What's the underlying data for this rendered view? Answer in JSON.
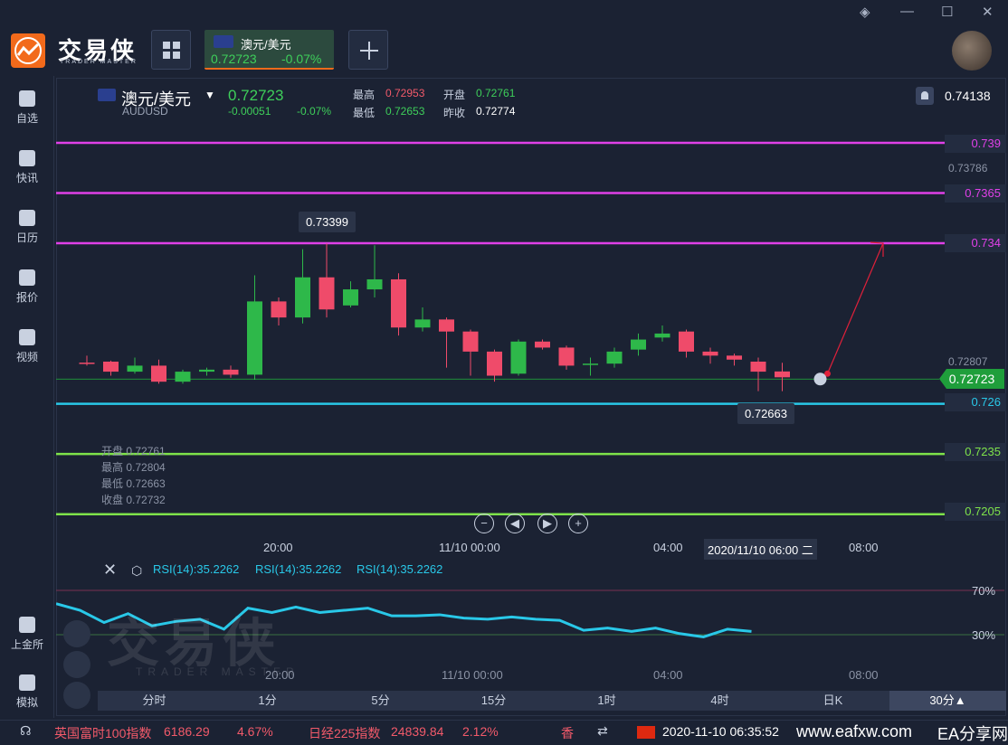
{
  "app": {
    "logo_text": "交易侠",
    "logo_sub": "TRADER MASTER",
    "window_controls": [
      "layers-icon",
      "minimize-icon",
      "maximize-icon",
      "close-icon"
    ]
  },
  "symbol_tab": {
    "name": "澳元/美元",
    "price": "0.72723",
    "change_pct": "-0.07%"
  },
  "sidebar": {
    "items": [
      {
        "label": "自选",
        "icon": "star-plus-icon"
      },
      {
        "label": "快讯",
        "icon": "news-icon"
      },
      {
        "label": "日历",
        "icon": "calendar-icon"
      },
      {
        "label": "报价",
        "icon": "chart-line-icon"
      },
      {
        "label": "视频",
        "icon": "video-icon"
      },
      {
        "label": "上金所",
        "icon": "exchange-icon"
      },
      {
        "label": "模拟",
        "icon": "wallet-icon"
      }
    ]
  },
  "header": {
    "name": "澳元/美元",
    "code": "AUDUSD",
    "price": "0.72723",
    "change": "-0.00051",
    "change_pct": "-0.07%",
    "high_label": "最高",
    "high": "0.72953",
    "open_label": "开盘",
    "open": "0.72761",
    "low_label": "最低",
    "low": "0.72653",
    "prev_label": "昨收",
    "prev": "0.72774",
    "alert_price": "0.74138"
  },
  "levels": {
    "l739": "0.739",
    "l7365": "0.7365",
    "l734": "0.734",
    "l726": "0.726",
    "l7235": "0.7235",
    "l7205": "0.7205",
    "grey_top": "0.73786",
    "grey_mid": "0.72807",
    "current": "0.72723"
  },
  "callouts": {
    "high": "0.73399",
    "low": "0.72663"
  },
  "ohlc_legend": {
    "open": "开盘 0.72761",
    "high": "最高 0.72804",
    "low": "最低 0.72663",
    "close": "收盘 0.72732"
  },
  "nav": [
    "−",
    "◀",
    "▶",
    "+"
  ],
  "time_axis": {
    "t1": "20:00",
    "t2": "11/10 00:00",
    "t3": "04:00",
    "hover": "2020/11/10 06:00 二",
    "t4": "08:00"
  },
  "rsi": {
    "label1": "RSI(14):35.2262",
    "label2": "RSI(14):35.2262",
    "label3": "RSI(14):35.2262",
    "p70": "70%",
    "p30": "30%"
  },
  "timeframes": [
    "分时",
    "1分",
    "5分",
    "15分",
    "1时",
    "4时",
    "日K",
    "30分▲"
  ],
  "ticker": {
    "item1_name": "英国富时100指数",
    "item1_val": "6186.29",
    "item1_pct": "4.67%",
    "item2_name": "日经225指数",
    "item2_val": "24839.84",
    "item2_pct": "2.12%",
    "item3_name": "香",
    "datetime": "2020-11-10 06:35:52",
    "watermark": "www.eafxw.com",
    "watermark2": "EA分享网"
  },
  "chart_data": {
    "type": "candlestick",
    "candles": [
      {
        "o": 0.72805,
        "h": 0.7284,
        "l": 0.7279,
        "c": 0.728
      },
      {
        "o": 0.7281,
        "h": 0.72815,
        "l": 0.7274,
        "c": 0.7276
      },
      {
        "o": 0.7276,
        "h": 0.7283,
        "l": 0.7275,
        "c": 0.7279
      },
      {
        "o": 0.7279,
        "h": 0.7282,
        "l": 0.727,
        "c": 0.7271
      },
      {
        "o": 0.7271,
        "h": 0.7277,
        "l": 0.727,
        "c": 0.7276
      },
      {
        "o": 0.7276,
        "h": 0.7278,
        "l": 0.7274,
        "c": 0.7277
      },
      {
        "o": 0.7277,
        "h": 0.7279,
        "l": 0.7273,
        "c": 0.72745
      },
      {
        "o": 0.72745,
        "h": 0.7324,
        "l": 0.7272,
        "c": 0.7311
      },
      {
        "o": 0.7311,
        "h": 0.7313,
        "l": 0.7299,
        "c": 0.7303
      },
      {
        "o": 0.7303,
        "h": 0.7337,
        "l": 0.73,
        "c": 0.7323
      },
      {
        "o": 0.7323,
        "h": 0.73399,
        "l": 0.7303,
        "c": 0.7307
      },
      {
        "o": 0.7309,
        "h": 0.7321,
        "l": 0.7308,
        "c": 0.7317
      },
      {
        "o": 0.7317,
        "h": 0.7339,
        "l": 0.7313,
        "c": 0.7322
      },
      {
        "o": 0.7322,
        "h": 0.7325,
        "l": 0.7294,
        "c": 0.7298
      },
      {
        "o": 0.7298,
        "h": 0.7308,
        "l": 0.7296,
        "c": 0.7302
      },
      {
        "o": 0.7302,
        "h": 0.7303,
        "l": 0.7278,
        "c": 0.7296
      },
      {
        "o": 0.7296,
        "h": 0.7297,
        "l": 0.7274,
        "c": 0.7286
      },
      {
        "o": 0.7286,
        "h": 0.7287,
        "l": 0.7271,
        "c": 0.7274
      },
      {
        "o": 0.7275,
        "h": 0.7292,
        "l": 0.7274,
        "c": 0.7291
      },
      {
        "o": 0.7291,
        "h": 0.7292,
        "l": 0.7287,
        "c": 0.7288
      },
      {
        "o": 0.7288,
        "h": 0.7289,
        "l": 0.7277,
        "c": 0.7279
      },
      {
        "o": 0.728,
        "h": 0.7283,
        "l": 0.7274,
        "c": 0.728
      },
      {
        "o": 0.728,
        "h": 0.7288,
        "l": 0.7278,
        "c": 0.7286
      },
      {
        "o": 0.7287,
        "h": 0.7295,
        "l": 0.7284,
        "c": 0.7292
      },
      {
        "o": 0.7293,
        "h": 0.7299,
        "l": 0.7291,
        "c": 0.7295
      },
      {
        "o": 0.7296,
        "h": 0.7297,
        "l": 0.7283,
        "c": 0.7286
      },
      {
        "o": 0.7286,
        "h": 0.7288,
        "l": 0.728,
        "c": 0.7284
      },
      {
        "o": 0.7284,
        "h": 0.7285,
        "l": 0.7279,
        "c": 0.7282
      },
      {
        "o": 0.7281,
        "h": 0.7283,
        "l": 0.72663,
        "c": 0.7276
      },
      {
        "o": 0.72761,
        "h": 0.72804,
        "l": 0.72663,
        "c": 0.72732
      }
    ],
    "rsi": [
      58,
      52,
      41,
      49,
      38,
      42,
      44,
      35,
      54,
      50,
      55,
      50,
      52,
      54,
      47,
      47,
      48,
      45,
      44,
      46,
      44,
      43,
      34,
      36,
      33,
      36,
      31,
      28,
      35,
      33
    ],
    "rsi_levels": [
      70,
      30
    ],
    "ylim": [
      0.7195,
      0.7405
    ]
  }
}
